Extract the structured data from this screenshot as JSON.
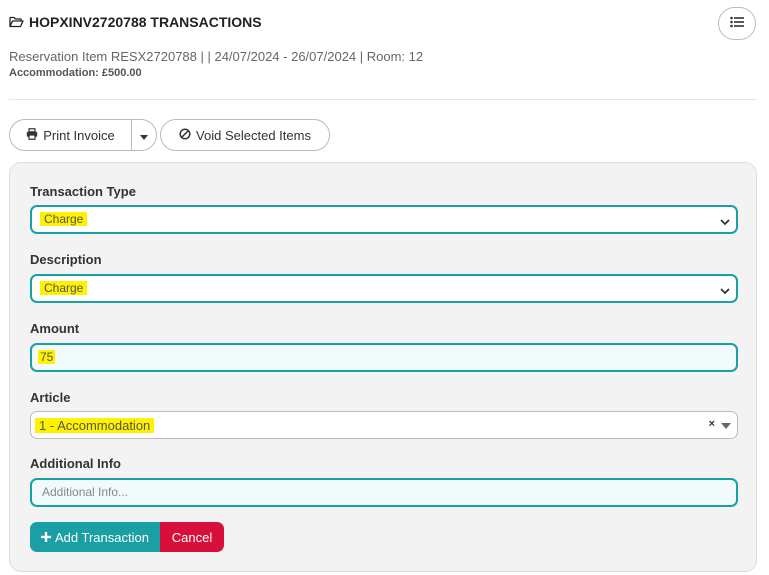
{
  "header": {
    "title": "HOPXINV2720788 TRANSACTIONS",
    "subtitle": "Reservation Item RESX2720788 | | 24/07/2024 - 26/07/2024 | Room: 12",
    "accommodation": "Accommodation: £500.00"
  },
  "toolbar": {
    "print_label": "Print Invoice",
    "void_label": "Void Selected Items"
  },
  "form": {
    "transaction_type": {
      "label": "Transaction Type",
      "value": "Charge"
    },
    "description": {
      "label": "Description",
      "value": "Charge"
    },
    "amount": {
      "label": "Amount",
      "value": "75"
    },
    "article": {
      "label": "Article",
      "value": "1 - Accommodation",
      "clear": "×"
    },
    "additional_info": {
      "label": "Additional Info",
      "placeholder": "Additional Info..."
    },
    "add_label": "Add Transaction",
    "cancel_label": "Cancel"
  },
  "colors": {
    "accent": "#1a9fa4",
    "danger": "#d6103a",
    "highlight": "#fff200"
  },
  "icons": {
    "title": "folder-open-icon",
    "list": "list-icon",
    "print": "print-icon",
    "caret": "caret-down-icon",
    "void": "ban-icon",
    "add": "plus-icon"
  }
}
